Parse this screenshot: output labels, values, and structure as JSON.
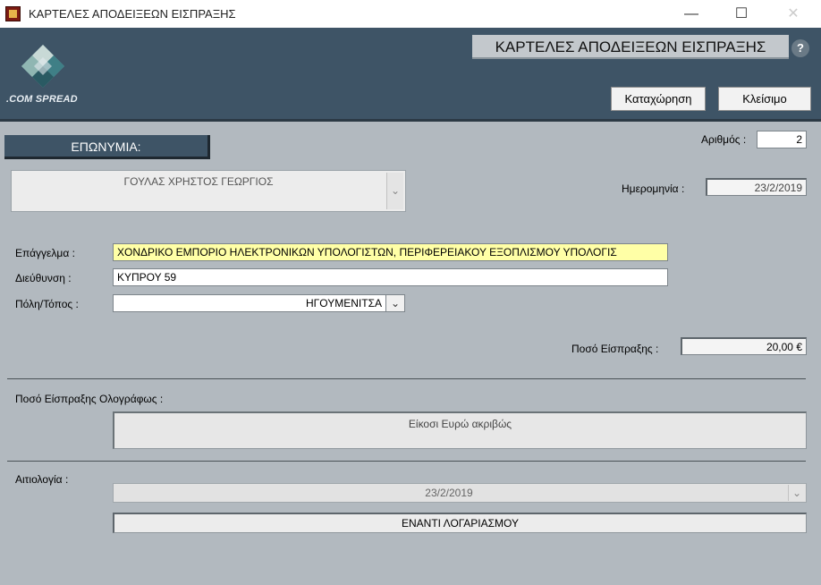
{
  "window": {
    "title": "ΚΑΡΤΕΛΕΣ ΑΠΟΔΕΙΞΕΩΝ ΕΙΣΠΡΑΞΗΣ",
    "minimize": "—",
    "maximize": "☐",
    "close": "✕"
  },
  "header": {
    "logo_text": ".COM SPREAD",
    "form_title": "ΚΑΡΤΕΛΕΣ ΑΠΟΔΕΙΞΕΩΝ ΕΙΣΠΡΑΞΗΣ",
    "help": "?",
    "save_label": "Καταχώρηση",
    "close_label": "Κλείσιμο"
  },
  "form": {
    "eponymia_label": "ΕΠΩΝΥΜΙΑ:",
    "name_value": "ΓΟΥΛΑΣ  ΧΡΗΣΤΟΣ ΓΕΩΡΓΙΟΣ",
    "number_label": "Αριθμός :",
    "number_value": "2",
    "date_label": "Ημερομηνία :",
    "date_value": "23/2/2019",
    "profession_label": "Επάγγελμα :",
    "profession_value": "ΧΟΝΔΡΙΚΟ ΕΜΠΟΡΙΟ ΗΛΕΚΤΡΟΝΙΚΩΝ ΥΠΟΛΟΓΙΣΤΩΝ, ΠΕΡΙΦΕΡΕΙΑΚΟΥ ΕΞΟΠΛΙΣΜΟΥ ΥΠΟΛΟΓΙΣ",
    "address_label": "Διεύθυνση :",
    "address_value": "ΚΥΠΡΟΥ 59",
    "city_label": "Πόλη/Τόπος :",
    "city_value": "ΗΓΟΥΜΕΝΙΤΣΑ",
    "amount_label": "Ποσό Είσπραξης :",
    "amount_value": "20,00 €",
    "amount_words_label": "Ποσό Είσπραξης Ολογράφως :",
    "amount_words_value": "Είκοσι  Ευρώ ακριβώς",
    "reason_label": "Αιτιολογία :",
    "reason_combo_value": "23/2/2019",
    "reason_value": "ΕΝΑΝΤΙ ΛΟΓΑΡΙΑΣΜΟΥ"
  },
  "colors": {
    "header_bg": "#3e5466",
    "form_bg": "#b2b9bf",
    "highlight_field": "#ffffa6"
  },
  "icons": {
    "app": "app-icon",
    "help": "question-mark-icon",
    "dropdown": "chevron-down-icon"
  }
}
